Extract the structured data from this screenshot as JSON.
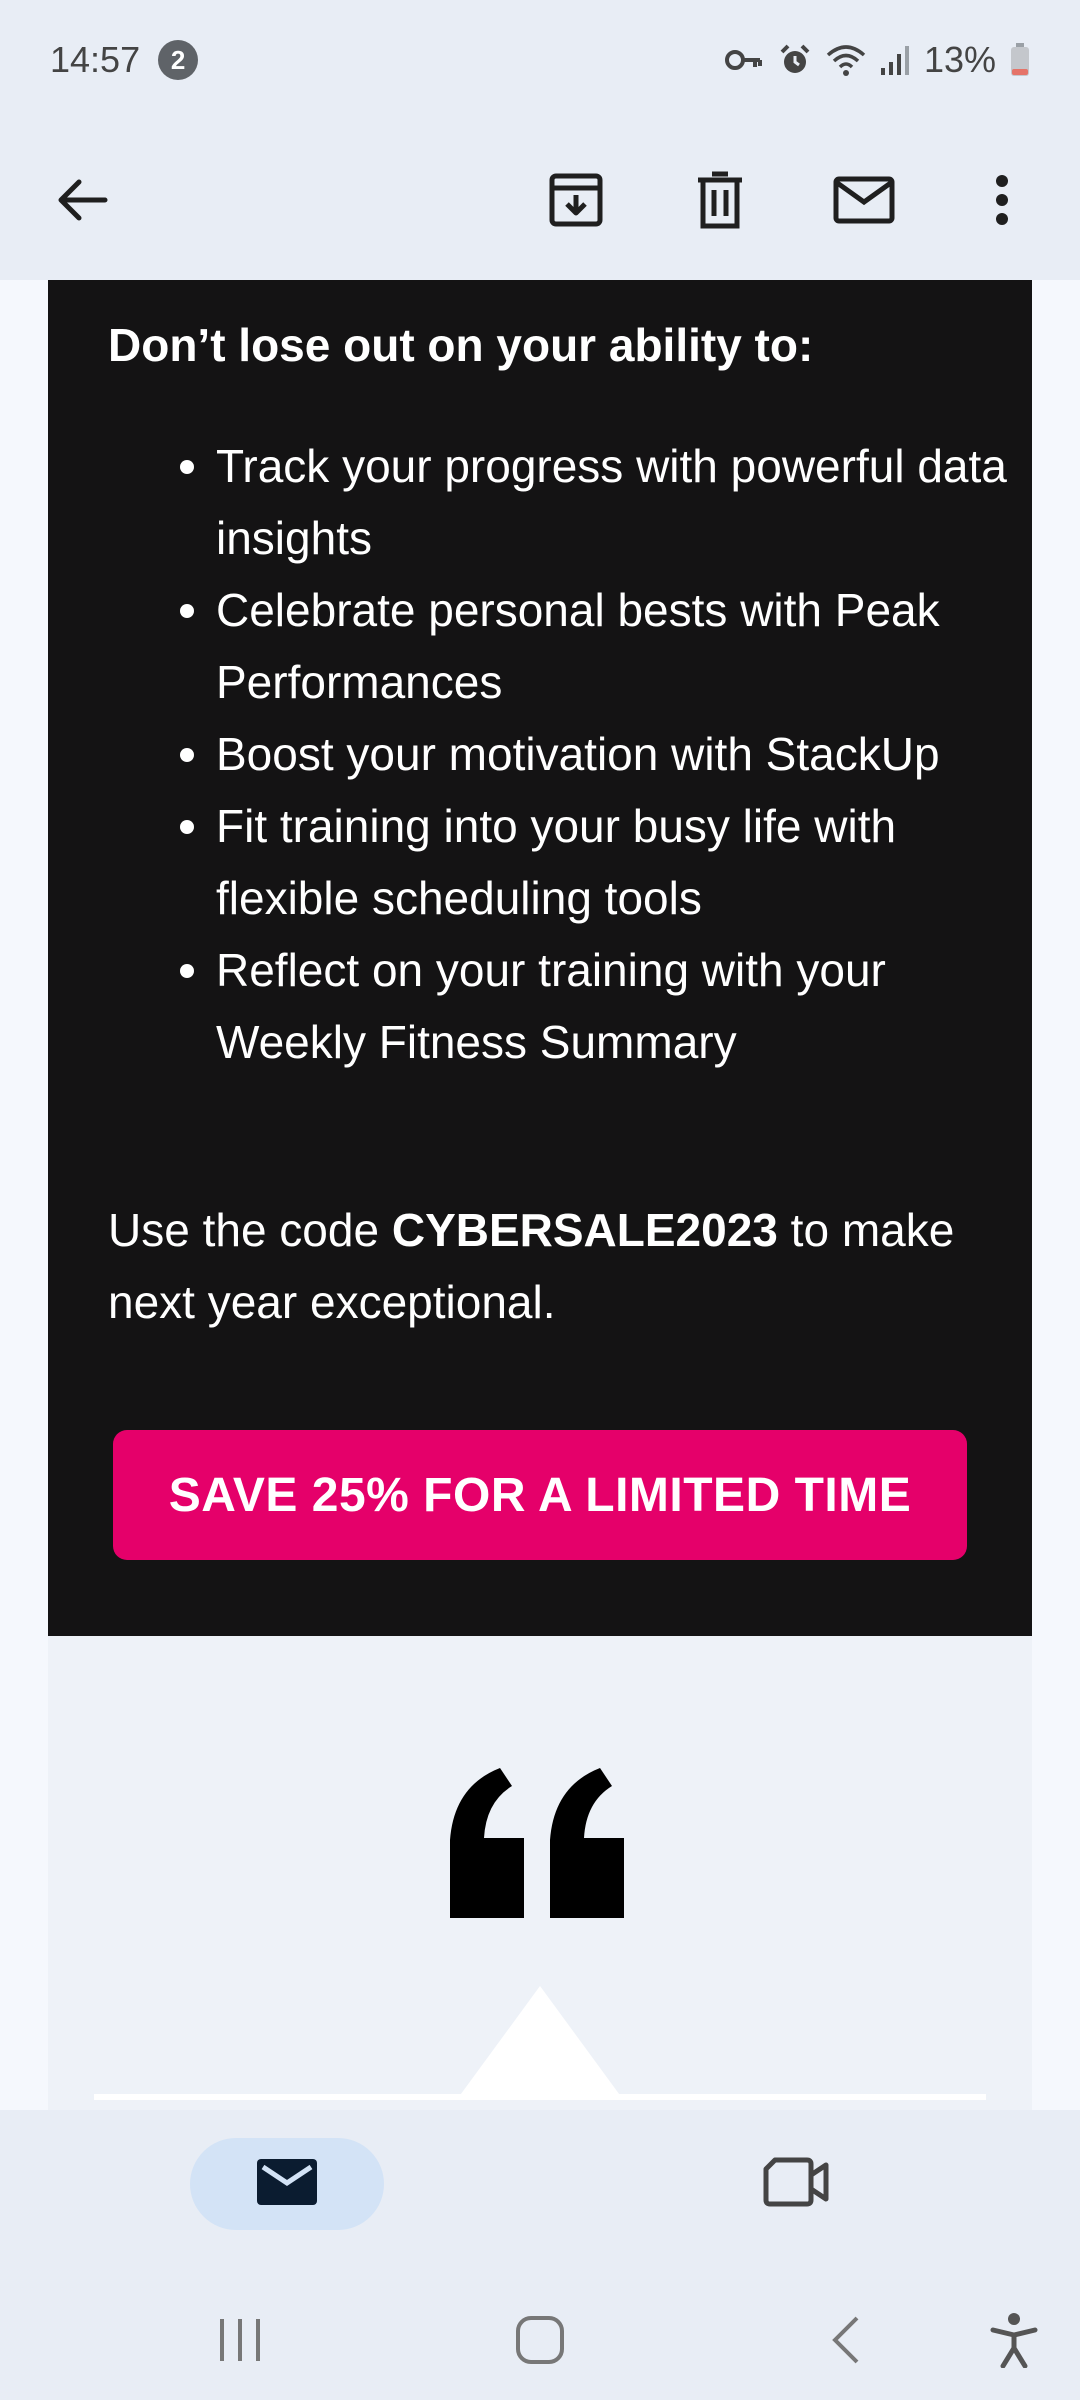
{
  "status_bar": {
    "time": "14:57",
    "notification_count": "2",
    "battery": "13%",
    "icons": [
      "vpn-key-icon",
      "alarm-icon",
      "wifi-icon",
      "signal-icon",
      "battery-icon"
    ]
  },
  "toolbar": {
    "icons": [
      "back-arrow-icon",
      "archive-icon",
      "delete-icon",
      "mark-unread-icon",
      "more-options-icon"
    ]
  },
  "email": {
    "heading": "Don’t lose out on your ability to:",
    "benefits": [
      "Track your progress with powerful data insights",
      "Celebrate personal bests with Peak Performances",
      "Boost your motivation with StackUp",
      "Fit training into your busy life with flexible scheduling tools",
      "Reflect on your training with your Weekly Fitness Summary"
    ],
    "code_prefix": "Use the code ",
    "code": "CYBERSALE2023",
    "code_suffix": " to make next year exceptional.",
    "cta_label": "SAVE 25% FOR A LIMITED TIME",
    "colors": {
      "card_background": "#141314",
      "cta_background": "#e5006a"
    }
  },
  "bottom_nav": {
    "items": [
      "mail-icon",
      "video-meet-icon"
    ],
    "active": "mail"
  },
  "system_nav": {
    "icons": [
      "recents-icon",
      "home-icon",
      "back-icon",
      "accessibility-icon"
    ]
  }
}
